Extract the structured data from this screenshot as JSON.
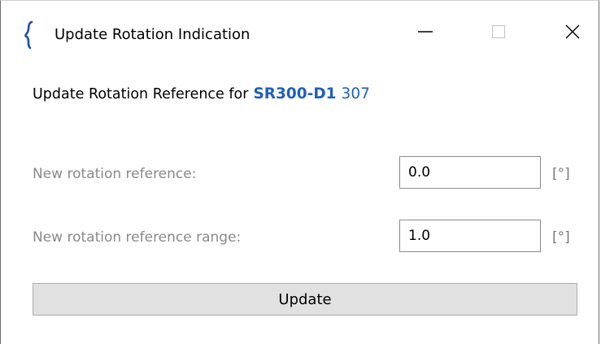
{
  "window": {
    "title": "Update Rotation Indication",
    "controls": {
      "minimize": "minimize-icon",
      "maximize": "maximize-icon",
      "close": "close-icon"
    }
  },
  "heading": {
    "text": "Update Rotation Reference for",
    "device": "SR300-D1",
    "number": "307",
    "accent_color": "#1f5fbf"
  },
  "fields": [
    {
      "label": "New rotation reference:",
      "value": "0.0",
      "unit": "[°]"
    },
    {
      "label": "New rotation reference range:",
      "value": "1.0",
      "unit": "[°]"
    }
  ],
  "actions": {
    "update_label": "Update"
  }
}
